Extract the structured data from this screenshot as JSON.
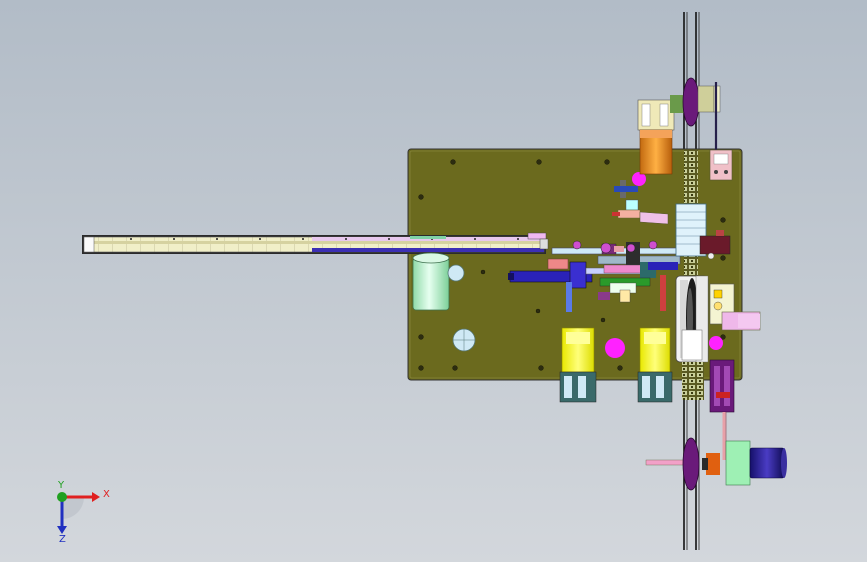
{
  "viewport": {
    "background_top": "#b2bcc7",
    "background_bottom": "#d3d7dc"
  },
  "model": {
    "base_plate_color": "#6b6a1e",
    "conveyor_rail_color": "#f0eec0",
    "belt_color": "#e9efe7",
    "cylinder_color": "#ffff33",
    "motor_color": "#2a1a8a",
    "accent_magenta": "#ff00ff",
    "accent_purple": "#6a1a7a",
    "accent_orange": "#e58a1a",
    "accent_cyan": "#cfe9f5",
    "accent_green": "#b8f2cc",
    "accent_pink": "#e8a0a8"
  },
  "triad": {
    "x_label": "X",
    "y_label": "Y",
    "z_label": "Z",
    "x_color": "#e02020",
    "y_color": "#20a020",
    "z_color": "#2030c0"
  }
}
